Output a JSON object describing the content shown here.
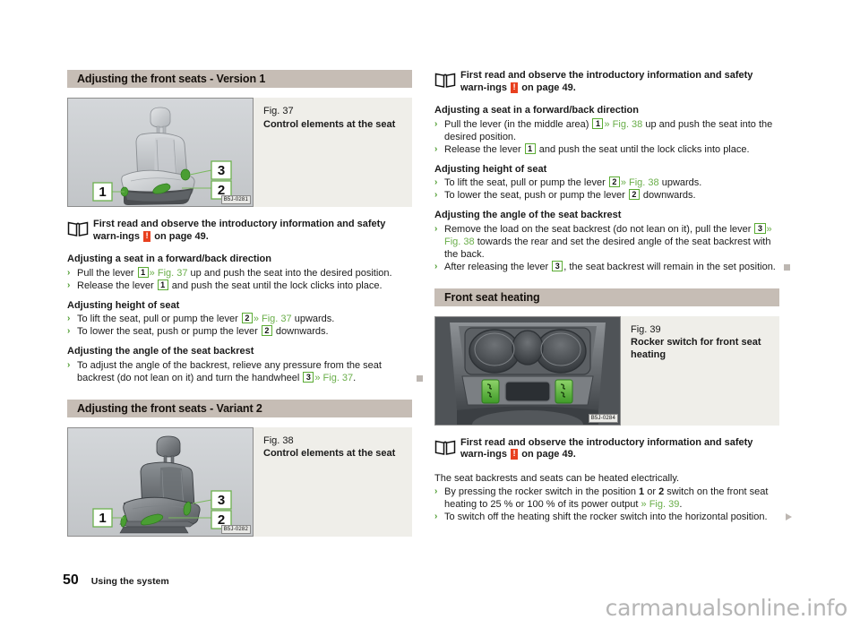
{
  "page": {
    "number": "50",
    "section": "Using the system",
    "watermark": "carmanualsonline.info"
  },
  "left_column": {
    "section1": {
      "header": "Adjusting the front seats - Version 1",
      "figure": {
        "number": "Fig. 37",
        "title": "Control elements at the seat",
        "image_code": "B5J-0281",
        "callouts": [
          "1",
          "2",
          "3"
        ],
        "alt": "car front seat with green highlighted control levers"
      },
      "note": {
        "text_before": "First read and observe the introductory information and safety warn-ings",
        "badge": "!",
        "text_after": "on page 49."
      },
      "groups": [
        {
          "heading": "Adjusting a seat in a forward/back direction",
          "items": [
            {
              "parts": [
                {
                  "t": "text",
                  "v": "Pull the lever "
                },
                {
                  "t": "ref",
                  "v": "1"
                },
                {
                  "t": "xref",
                  "v": "» Fig. 37"
                },
                {
                  "t": "text",
                  "v": " up and push the seat into the desired position."
                }
              ]
            },
            {
              "parts": [
                {
                  "t": "text",
                  "v": "Release the lever "
                },
                {
                  "t": "ref",
                  "v": "1"
                },
                {
                  "t": "text",
                  "v": " and push the seat until the lock clicks into place."
                }
              ]
            }
          ]
        },
        {
          "heading": "Adjusting height of seat",
          "items": [
            {
              "parts": [
                {
                  "t": "text",
                  "v": "To lift the seat, pull or pump the lever "
                },
                {
                  "t": "ref",
                  "v": "2"
                },
                {
                  "t": "xref",
                  "v": "» Fig. 37"
                },
                {
                  "t": "text",
                  "v": " upwards."
                }
              ]
            },
            {
              "parts": [
                {
                  "t": "text",
                  "v": "To lower the seat, push or pump the lever "
                },
                {
                  "t": "ref",
                  "v": "2"
                },
                {
                  "t": "text",
                  "v": " downwards."
                }
              ]
            }
          ]
        },
        {
          "heading": "Adjusting the angle of the seat backrest",
          "items": [
            {
              "end_marker": "square",
              "parts": [
                {
                  "t": "text",
                  "v": "To adjust the angle of the backrest, relieve any pressure from the seat backrest (do not lean on it) and turn the handwheel "
                },
                {
                  "t": "ref",
                  "v": "3"
                },
                {
                  "t": "xref",
                  "v": "» Fig. 37"
                },
                {
                  "t": "text",
                  "v": "."
                }
              ]
            }
          ]
        }
      ]
    },
    "section2": {
      "header": "Adjusting the front seats - Variant 2",
      "figure": {
        "number": "Fig. 38",
        "title": "Control elements at the seat",
        "image_code": "B5J-0282",
        "callouts": [
          "1",
          "2",
          "3"
        ],
        "alt": "dark car front seat with green highlighted control levers"
      }
    }
  },
  "right_column": {
    "section1": {
      "note": {
        "text_before": "First read and observe the introductory information and safety warn-ings",
        "badge": "!",
        "text_after": "on page 49."
      },
      "groups": [
        {
          "heading": "Adjusting a seat in a forward/back direction",
          "items": [
            {
              "parts": [
                {
                  "t": "text",
                  "v": "Pull the lever (in the middle area) "
                },
                {
                  "t": "ref",
                  "v": "1"
                },
                {
                  "t": "xref",
                  "v": "» Fig. 38"
                },
                {
                  "t": "text",
                  "v": " up and push the seat into the desired position."
                }
              ]
            },
            {
              "parts": [
                {
                  "t": "text",
                  "v": "Release the lever "
                },
                {
                  "t": "ref",
                  "v": "1"
                },
                {
                  "t": "text",
                  "v": " and push the seat until the lock clicks into place."
                }
              ]
            }
          ]
        },
        {
          "heading": "Adjusting height of seat",
          "items": [
            {
              "parts": [
                {
                  "t": "text",
                  "v": "To lift the seat, pull or pump the lever "
                },
                {
                  "t": "ref",
                  "v": "2"
                },
                {
                  "t": "xref",
                  "v": "» Fig. 38"
                },
                {
                  "t": "text",
                  "v": " upwards."
                }
              ]
            },
            {
              "parts": [
                {
                  "t": "text",
                  "v": "To lower the seat, push or pump the lever "
                },
                {
                  "t": "ref",
                  "v": "2"
                },
                {
                  "t": "text",
                  "v": " downwards."
                }
              ]
            }
          ]
        },
        {
          "heading": "Adjusting the angle of the seat backrest",
          "items": [
            {
              "parts": [
                {
                  "t": "text",
                  "v": "Remove the load on the seat backrest (do not lean on it), pull the lever "
                },
                {
                  "t": "ref",
                  "v": "3"
                },
                {
                  "t": "xref",
                  "v": "» Fig. 38"
                },
                {
                  "t": "text",
                  "v": " towards the rear and set the desired angle of the seat backrest with the back."
                }
              ]
            },
            {
              "end_marker": "square",
              "parts": [
                {
                  "t": "text",
                  "v": "After releasing the lever "
                },
                {
                  "t": "ref",
                  "v": "3"
                },
                {
                  "t": "text",
                  "v": ", the seat backrest will remain in the set position."
                }
              ]
            }
          ]
        }
      ]
    },
    "section2": {
      "header": "Front seat heating",
      "figure": {
        "number": "Fig. 39",
        "title": "Rocker switch for front seat heating",
        "image_code": "B5J-0284",
        "alt": "center console with cup holders and two green rocker switches"
      },
      "note": {
        "text_before": "First read and observe the introductory information and safety warn-ings",
        "badge": "!",
        "text_after": "on page 49."
      },
      "intro": "The seat backrests and seats can be heated electrically.",
      "items": [
        {
          "parts": [
            {
              "t": "text",
              "v": "By pressing the rocker switch in the position "
            },
            {
              "t": "bold",
              "v": "1"
            },
            {
              "t": "text",
              "v": " or "
            },
            {
              "t": "bold",
              "v": "2"
            },
            {
              "t": "text",
              "v": " switch on the front seat heating to 25 % or 100 % of its power output "
            },
            {
              "t": "xref",
              "v": "» Fig. 39"
            },
            {
              "t": "text",
              "v": "."
            }
          ]
        },
        {
          "end_marker": "triangle",
          "parts": [
            {
              "t": "text",
              "v": "To switch off the heating shift the rocker switch into the horizontal position."
            }
          ]
        }
      ]
    }
  }
}
